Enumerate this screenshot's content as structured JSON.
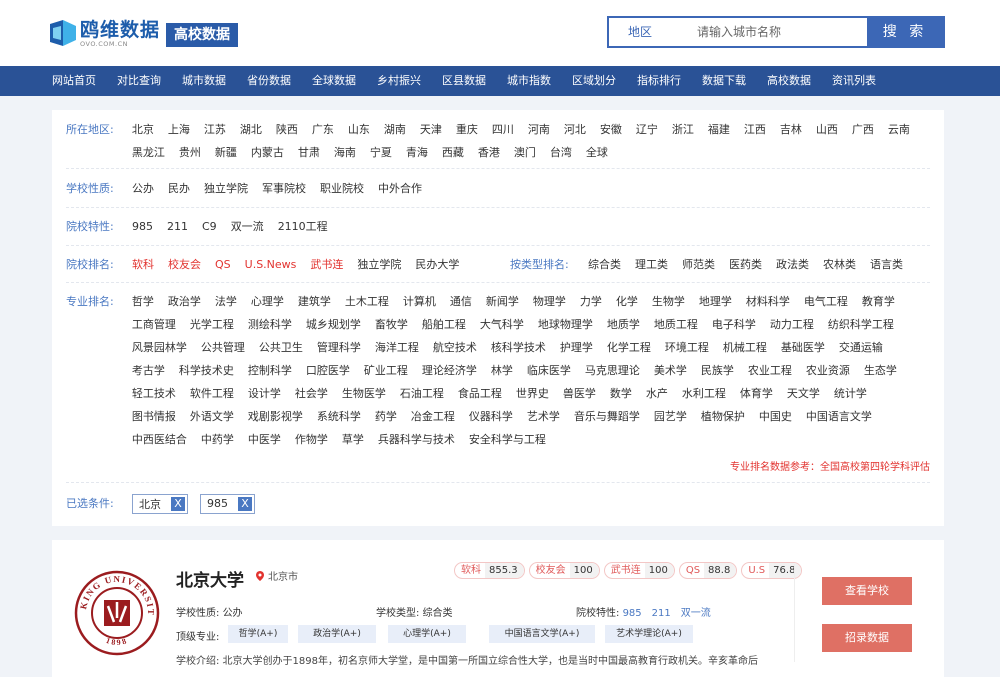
{
  "colors": {
    "brand": "#2a5296",
    "accent": "#3c67b6",
    "label": "#4a78c2",
    "red": "#e2332f",
    "button": "#df7064"
  },
  "header": {
    "logo_name": "鸥维数据",
    "logo_sub": "OVO.COM.CN",
    "badge": "高校数据",
    "search": {
      "label": "地区",
      "placeholder": "请输入城市名称",
      "button": "搜 索"
    }
  },
  "nav": [
    "网站首页",
    "对比查询",
    "城市数据",
    "省份数据",
    "全球数据",
    "乡村振兴",
    "区县数据",
    "城市指数",
    "区域划分",
    "指标排行",
    "数据下载",
    "高校数据",
    "资讯列表"
  ],
  "filters": {
    "region": {
      "label": "所在地区:",
      "items": [
        "北京",
        "上海",
        "江苏",
        "湖北",
        "陕西",
        "广东",
        "山东",
        "湖南",
        "天津",
        "重庆",
        "四川",
        "河南",
        "河北",
        "安徽",
        "辽宁",
        "浙江",
        "福建",
        "江西",
        "吉林",
        "山西",
        "广西",
        "云南",
        "黑龙江",
        "贵州",
        "新疆",
        "内蒙古",
        "甘肃",
        "海南",
        "宁夏",
        "青海",
        "西藏",
        "香港",
        "澳门",
        "台湾",
        "全球"
      ]
    },
    "nature": {
      "label": "学校性质:",
      "items": [
        "公办",
        "民办",
        "独立学院",
        "军事院校",
        "职业院校",
        "中外合作"
      ]
    },
    "feature": {
      "label": "院校特性:",
      "items": [
        "985",
        "211",
        "C9",
        "双一流",
        "2110工程"
      ]
    },
    "ranking": {
      "label": "院校排名:",
      "items": [
        "软科",
        "校友会",
        "QS",
        "U.S.News",
        "武书连",
        "独立学院",
        "民办大学"
      ],
      "type_label": "按类型排名:",
      "type_items": [
        "综合类",
        "理工类",
        "师范类",
        "医药类",
        "政法类",
        "农林类",
        "语言类"
      ]
    },
    "major": {
      "label": "专业排名:",
      "items": [
        "哲学",
        "政治学",
        "法学",
        "心理学",
        "建筑学",
        "土木工程",
        "计算机",
        "通信",
        "新闻学",
        "物理学",
        "力学",
        "化学",
        "生物学",
        "地理学",
        "材料科学",
        "电气工程",
        "教育学",
        "工商管理",
        "光学工程",
        "测绘科学",
        "城乡规划学",
        "畜牧学",
        "船舶工程",
        "大气科学",
        "地球物理学",
        "地质学",
        "地质工程",
        "电子科学",
        "动力工程",
        "纺织科学工程",
        "风景园林学",
        "公共管理",
        "公共卫生",
        "管理科学",
        "海洋工程",
        "航空技术",
        "核科学技术",
        "护理学",
        "化学工程",
        "环境工程",
        "机械工程",
        "基础医学",
        "交通运输",
        "考古学",
        "科学技术史",
        "控制科学",
        "口腔医学",
        "矿业工程",
        "理论经济学",
        "林学",
        "临床医学",
        "马克思理论",
        "美术学",
        "民族学",
        "农业工程",
        "农业资源",
        "生态学",
        "轻工技术",
        "软件工程",
        "设计学",
        "社会学",
        "生物医学",
        "石油工程",
        "食品工程",
        "世界史",
        "兽医学",
        "数学",
        "水产",
        "水利工程",
        "体育学",
        "天文学",
        "统计学",
        "图书情报",
        "外语文学",
        "戏剧影视学",
        "系统科学",
        "药学",
        "冶金工程",
        "仪器科学",
        "艺术学",
        "音乐与舞蹈学",
        "园艺学",
        "植物保护",
        "中国史",
        "中国语言文学",
        "中西医结合",
        "中药学",
        "中医学",
        "作物学",
        "草学",
        "兵器科学与技术",
        "安全科学与工程"
      ],
      "note": "专业排名数据参考：全国高校第四轮学科评估"
    },
    "selected": {
      "label": "已选条件:",
      "items": [
        "北京",
        "985"
      ]
    }
  },
  "university": {
    "name": "北京大学",
    "location": "北京市",
    "rankings": [
      {
        "k": "软科",
        "v": "855.3"
      },
      {
        "k": "校友会",
        "v": "100"
      },
      {
        "k": "武书连",
        "v": "100"
      },
      {
        "k": "QS",
        "v": "88.8"
      },
      {
        "k": "U.S",
        "v": "76.8"
      }
    ],
    "nature_label": "学校性质:",
    "nature": "公办",
    "type_label": "学校类型:",
    "type": "综合类",
    "feature_label": "院校特性:",
    "features": [
      "985",
      "211",
      "双一流"
    ],
    "discipline_label": "顶级专业:",
    "disciplines": [
      "哲学(A+)",
      "政治学(A+)",
      "心理学(A+)",
      "中国语言文学(A+)",
      "艺术学理论(A+)"
    ],
    "intro": "学校介绍: 北京大学创办于1898年，初名京师大学堂，是中国第一所国立综合性大学，也是当时中国最高教育行政机关。辛亥革命后",
    "btn_view": "查看学校",
    "btn_admission": "招录数据",
    "seal_text": "PEKING UNIVERSITY",
    "seal_year": "1898"
  }
}
